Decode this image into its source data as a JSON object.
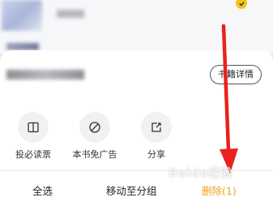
{
  "sheet": {
    "detail_button": "书籍详情",
    "actions": [
      {
        "label": "投必读票",
        "icon": "book-icon"
      },
      {
        "label": "本书免广告",
        "icon": "no-ad-icon"
      },
      {
        "label": "分享",
        "icon": "share-icon"
      }
    ]
  },
  "bottom_bar": {
    "select_all": "全选",
    "move_to_group": "移动至分组",
    "delete": "删除(1)"
  },
  "colors": {
    "accent": "#f4c21c",
    "annotation_arrow": "#e8221c"
  }
}
